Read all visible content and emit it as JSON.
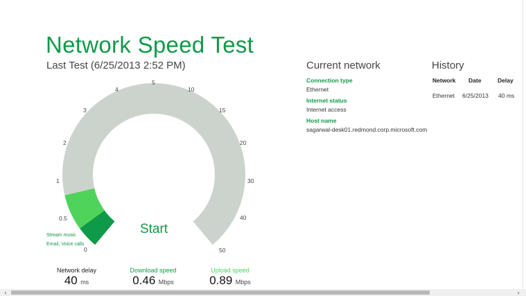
{
  "app": {
    "title": "Network Speed Test",
    "last_test": "Last Test (6/25/2013 2:52 PM)"
  },
  "gauge": {
    "tick_labels": [
      "0",
      "0.5",
      "1",
      "2",
      "3",
      "4",
      "5",
      "10",
      "15",
      "20",
      "30",
      "40",
      "50"
    ],
    "legend": [
      "Stream music",
      "Email, Voice calls"
    ],
    "start_label": "Start",
    "colors": {
      "track": "#ccd3cc",
      "band_inner": "#0e9a48",
      "band_outer": "#4fd35a"
    }
  },
  "metrics": {
    "network_delay": {
      "label": "Network delay",
      "value": "40",
      "unit": "ms",
      "color": "#222222"
    },
    "download_speed": {
      "label": "Download speed",
      "value": "0.46",
      "unit": "Mbps",
      "color": "#0e9a48"
    },
    "upload_speed": {
      "label": "Upload speed",
      "value": "0.89",
      "unit": "Mbps",
      "color": "#4fd35a"
    }
  },
  "current_network": {
    "title": "Current network",
    "connection_type_label": "Connection type",
    "connection_type_value": "Ethernet",
    "internet_status_label": "Internet status",
    "internet_status_value": "Internet access",
    "host_name_label": "Host name",
    "host_name_value": "sagarwal-desk01.redmond.corp.microsoft.com"
  },
  "history": {
    "title": "History",
    "columns": [
      "Network",
      "Date",
      "Delay"
    ],
    "rows": [
      [
        "Ethernet",
        "6/25/2013",
        "40 ms"
      ]
    ]
  },
  "scrollbar": {
    "left_arrow": "‹",
    "right_arrow": "›"
  },
  "theme": {
    "accent": "#0e9a48",
    "accent_light": "#4fd35a"
  }
}
